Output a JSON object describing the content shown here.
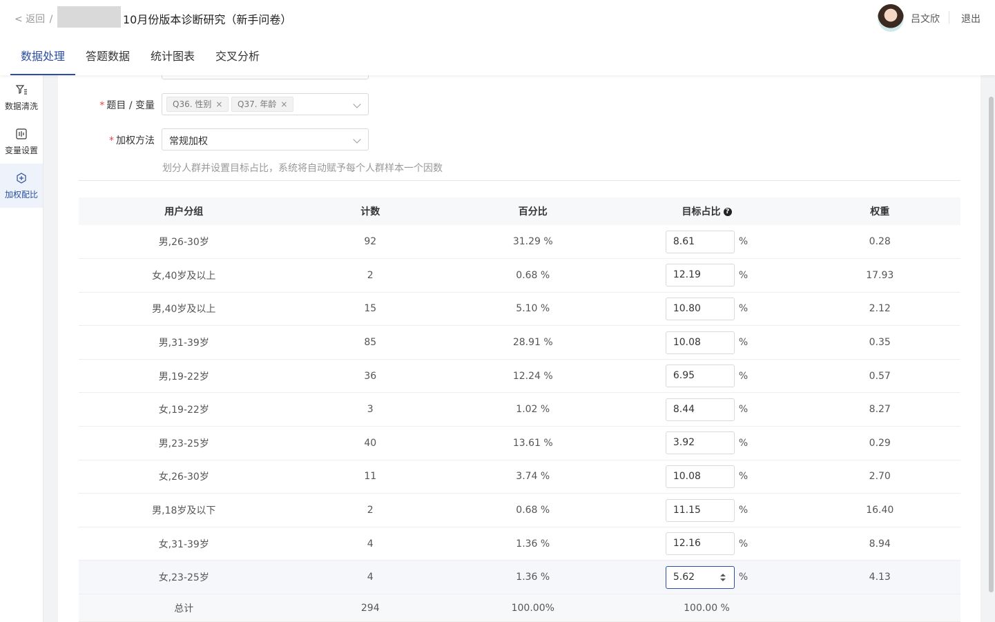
{
  "header": {
    "back_label": "< 返回",
    "back_sep": "/",
    "title": "10月份版本诊断研究（新手问卷）",
    "user_name": "吕文欣",
    "logout_label": "退出"
  },
  "tabs": [
    {
      "label": "数据处理"
    },
    {
      "label": "答题数据"
    },
    {
      "label": "统计图表"
    },
    {
      "label": "交叉分析"
    }
  ],
  "sidebar": {
    "items": [
      {
        "label": "数据清洗",
        "icon": "filter-icon"
      },
      {
        "label": "变量设置",
        "icon": "variable-icon"
      },
      {
        "label": "加权配比",
        "icon": "weight-icon"
      }
    ]
  },
  "form": {
    "variables_label": "题目 / 变量",
    "variables_tags": [
      "Q36. 性别",
      "Q37. 年龄"
    ],
    "tag_close": "×",
    "method_label": "加权方法",
    "method_value": "常规加权",
    "required_mark": "*",
    "hint": "划分人群并设置目标占比，系统将自动赋予每个人群样本一个因数"
  },
  "table": {
    "headers": {
      "group": "用户分组",
      "count": "计数",
      "percent": "百分比",
      "target": "目标占比",
      "weight": "权重",
      "help": "?"
    },
    "pct_suffix": "%",
    "rows": [
      {
        "group": "男,26-30岁",
        "count": "92",
        "percent": "31.29 %",
        "target": "8.61",
        "weight": "0.28"
      },
      {
        "group": "女,40岁及以上",
        "count": "2",
        "percent": "0.68 %",
        "target": "12.19",
        "weight": "17.93"
      },
      {
        "group": "男,40岁及以上",
        "count": "15",
        "percent": "5.10 %",
        "target": "10.80",
        "weight": "2.12"
      },
      {
        "group": "男,31-39岁",
        "count": "85",
        "percent": "28.91 %",
        "target": "10.08",
        "weight": "0.35"
      },
      {
        "group": "男,19-22岁",
        "count": "36",
        "percent": "12.24 %",
        "target": "6.95",
        "weight": "0.57"
      },
      {
        "group": "女,19-22岁",
        "count": "3",
        "percent": "1.02 %",
        "target": "8.44",
        "weight": "8.27"
      },
      {
        "group": "男,23-25岁",
        "count": "40",
        "percent": "13.61 %",
        "target": "3.92",
        "weight": "0.29"
      },
      {
        "group": "女,26-30岁",
        "count": "11",
        "percent": "3.74 %",
        "target": "10.08",
        "weight": "2.70"
      },
      {
        "group": "男,18岁及以下",
        "count": "2",
        "percent": "0.68 %",
        "target": "11.15",
        "weight": "16.40"
      },
      {
        "group": "女,31-39岁",
        "count": "4",
        "percent": "1.36 %",
        "target": "12.16",
        "weight": "8.94"
      },
      {
        "group": "女,23-25岁",
        "count": "4",
        "percent": "1.36 %",
        "target": "5.62",
        "weight": "4.13"
      }
    ],
    "total": {
      "label": "总计",
      "count": "294",
      "percent": "100.00%",
      "target": "100.00 %"
    }
  }
}
